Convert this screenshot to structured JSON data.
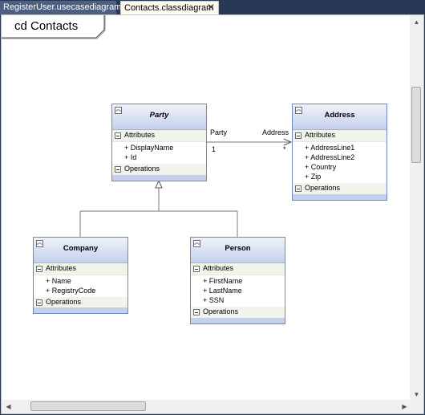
{
  "tabs": [
    {
      "label": "RegisterUser.usecasediagram",
      "active": false
    },
    {
      "label": "Contacts.classdiagram",
      "active": true
    }
  ],
  "tab_close_glyph": "✕",
  "diagram_frame": {
    "title": "cd Contacts"
  },
  "classes": {
    "party": {
      "name": "Party",
      "abstract": true,
      "attributes_label": "Attributes",
      "attributes": [
        "+ DisplayName",
        "+ Id"
      ],
      "operations_label": "Operations"
    },
    "address": {
      "name": "Address",
      "attributes_label": "Attributes",
      "attributes": [
        "+ AddressLine1",
        "+ AddressLine2",
        "+ Country",
        "+ Zip"
      ],
      "operations_label": "Operations"
    },
    "company": {
      "name": "Company",
      "attributes_label": "Attributes",
      "attributes": [
        "+ Name",
        "+ RegistryCode"
      ],
      "operations_label": "Operations"
    },
    "person": {
      "name": "Person",
      "attributes_label": "Attributes",
      "attributes": [
        "+ FirstName",
        "+ LastName",
        "+ SSN"
      ],
      "operations_label": "Operations"
    }
  },
  "association": {
    "source_role": "Party",
    "source_multiplicity": "1",
    "target_role": "Address",
    "target_multiplicity": "*"
  },
  "icons": {
    "collapse": "collapse-chevrons-icon",
    "compartment": "minus-icon",
    "close": "close-icon"
  },
  "colors": {
    "chrome": "#293955",
    "class_border": "#6d89c4",
    "class_header": "#c5d1ec",
    "active_tab": "#fdfbee"
  }
}
